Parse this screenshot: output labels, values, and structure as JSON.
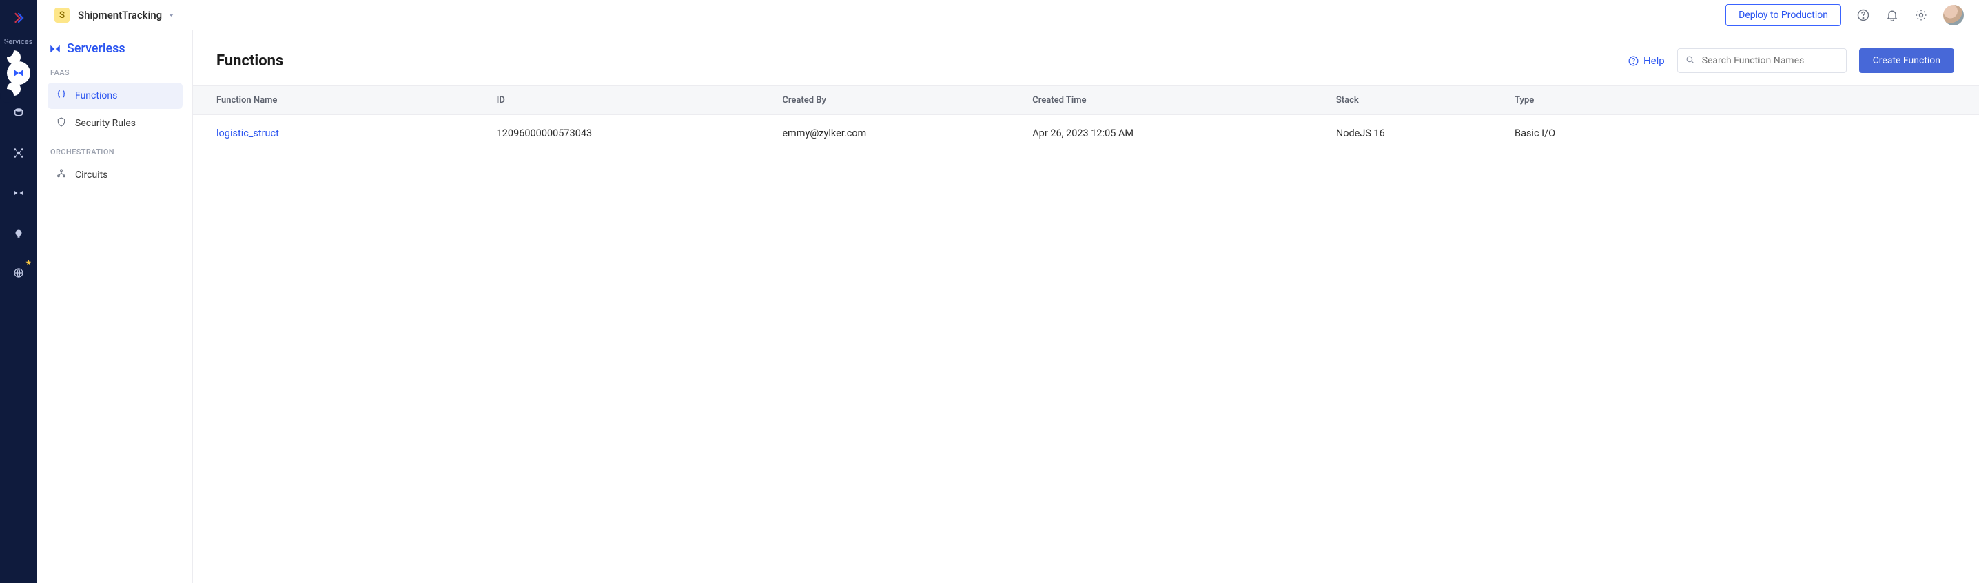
{
  "rail": {
    "services_label": "Services"
  },
  "project": {
    "initial": "S",
    "name": "ShipmentTracking"
  },
  "topbar": {
    "deploy_label": "Deploy to Production"
  },
  "sidebar": {
    "title": "Serverless",
    "groups": {
      "faas": {
        "label": "FAAS",
        "functions": "Functions",
        "security_rules": "Security Rules"
      },
      "orchestration": {
        "label": "ORCHESTRATION",
        "circuits": "Circuits"
      }
    }
  },
  "page": {
    "title": "Functions",
    "help_label": "Help",
    "search_placeholder": "Search Function Names",
    "create_label": "Create Function"
  },
  "table": {
    "headers": {
      "name": "Function Name",
      "id": "ID",
      "created_by": "Created By",
      "created_time": "Created Time",
      "stack": "Stack",
      "type": "Type"
    },
    "rows": [
      {
        "name": "logistic_struct",
        "id": "12096000000573043",
        "created_by": "emmy@zylker.com",
        "created_time": "Apr 26, 2023 12:05 AM",
        "stack": "NodeJS 16",
        "type": "Basic I/O"
      }
    ]
  }
}
